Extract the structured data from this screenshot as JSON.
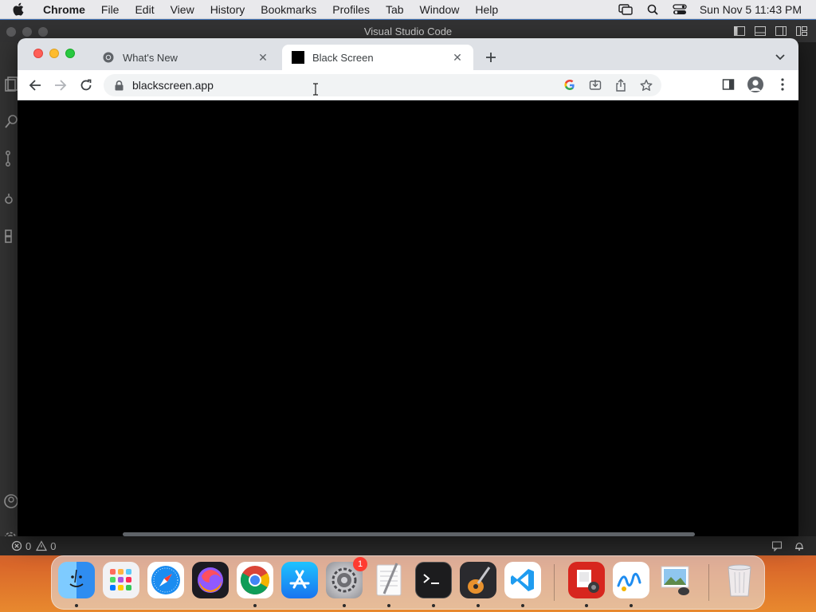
{
  "menubar": {
    "app_name": "Chrome",
    "items": [
      "File",
      "Edit",
      "View",
      "History",
      "Bookmarks",
      "Profiles",
      "Tab",
      "Window",
      "Help"
    ],
    "clock": "Sun Nov 5  11:43 PM"
  },
  "vscode": {
    "title": "Visual Studio Code",
    "status": {
      "errors": "0",
      "warnings": "0"
    }
  },
  "chrome": {
    "tabs": [
      {
        "title": "What's New",
        "icon": "chrome-icon",
        "active": false
      },
      {
        "title": "Black Screen",
        "icon": "black-square-icon",
        "active": true
      }
    ],
    "url": "blackscreen.app",
    "content_color": "#000000"
  },
  "dock": {
    "apps": [
      {
        "name": "Finder",
        "running": true
      },
      {
        "name": "Launchpad",
        "running": false
      },
      {
        "name": "Safari",
        "running": false
      },
      {
        "name": "Firefox",
        "running": false
      },
      {
        "name": "Chrome",
        "running": true
      },
      {
        "name": "App Store",
        "running": false
      },
      {
        "name": "System Preferences",
        "running": true,
        "badge": "1"
      },
      {
        "name": "TextEdit",
        "running": true
      },
      {
        "name": "Terminal",
        "running": true
      },
      {
        "name": "GarageBand",
        "running": true
      },
      {
        "name": "Visual Studio Code",
        "running": true
      },
      {
        "name": "Photo Booth",
        "running": true
      },
      {
        "name": "Freeform",
        "running": true
      },
      {
        "name": "Preview",
        "running": false
      },
      {
        "name": "Trash",
        "running": false
      }
    ]
  }
}
